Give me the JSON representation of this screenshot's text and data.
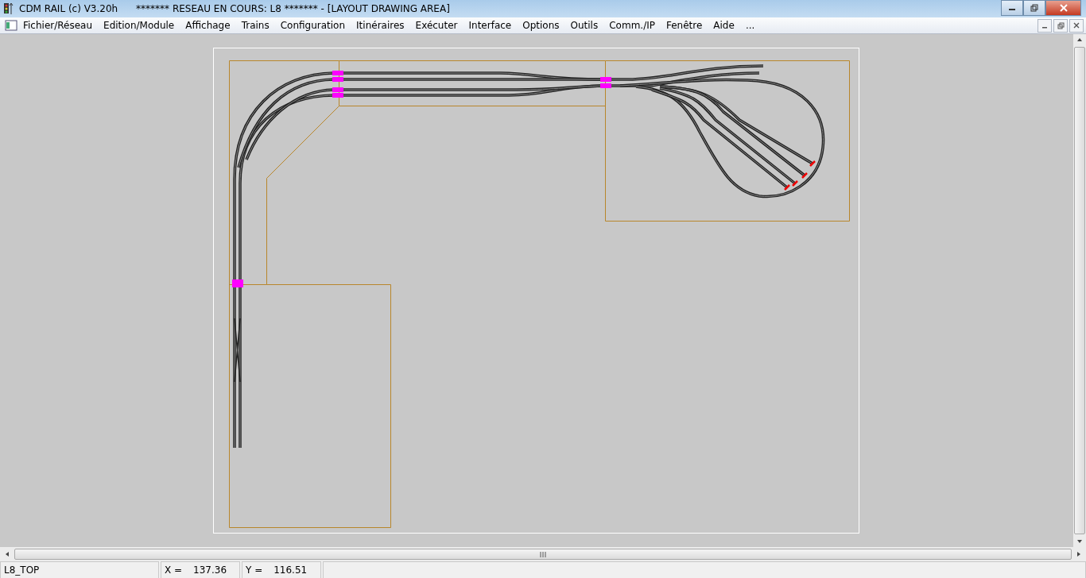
{
  "window": {
    "title": "CDM RAIL (c) V3.20h      ******* RESEAU EN COURS: L8 ******* - [LAYOUT DRAWING AREA]"
  },
  "menu": [
    {
      "label": "Fichier/Réseau"
    },
    {
      "label": "Edition/Module"
    },
    {
      "label": "Affichage"
    },
    {
      "label": "Trains"
    },
    {
      "label": "Configuration"
    },
    {
      "label": "Itinéraires"
    },
    {
      "label": "Exécuter"
    },
    {
      "label": "Interface"
    },
    {
      "label": "Options"
    },
    {
      "label": "Outils"
    },
    {
      "label": "Comm./IP"
    },
    {
      "label": "Fenêtre"
    },
    {
      "label": "Aide"
    },
    {
      "label": "..."
    }
  ],
  "status_bar": {
    "module": "L8_TOP",
    "x_label": "X =",
    "x_value": "137.36",
    "y_label": "Y =",
    "y_value": "116.51"
  }
}
